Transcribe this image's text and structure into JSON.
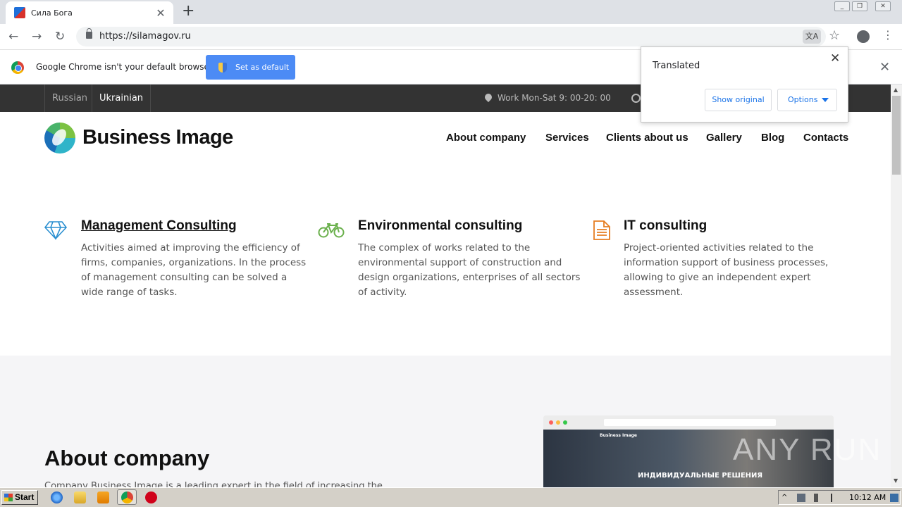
{
  "browser": {
    "tab_title": "Сила Бога",
    "url": "https://silamagov.ru",
    "new_tab_symbol": "+",
    "tab_close_symbol": "✕"
  },
  "infobar": {
    "message": "Google Chrome isn't your default browser",
    "button": "Set as default",
    "close_symbol": "✕"
  },
  "translate_popup": {
    "title": "Translated",
    "show_original": "Show original",
    "options": "Options",
    "close_symbol": "✕"
  },
  "site": {
    "languages": [
      "Russian",
      "Ukrainian"
    ],
    "hours": "Work Mon-Sat 9: 00-20: 00",
    "logo_text": "Business Image",
    "nav": [
      "About company",
      "Services",
      "Clients about us",
      "Gallery",
      "Blog",
      "Contacts"
    ],
    "services": [
      {
        "title": "Management Consulting",
        "desc": "Activities aimed at improving the efficiency of firms, companies, organizations. In the process of management consulting can be solved a wide range of tasks.",
        "icon": "diamond-icon",
        "color": "#2a8fd0"
      },
      {
        "title": "Environmental consulting",
        "desc": "The complex of works related to the environmental support of construction and design organizations, enterprises of all sectors of activity.",
        "icon": "bicycle-icon",
        "color": "#6ab04c"
      },
      {
        "title": "IT consulting",
        "desc": "Project-oriented activities related to the information support of business processes, allowing to give an independent expert assessment.",
        "icon": "document-icon",
        "color": "#e67e22"
      }
    ],
    "about_title": "About company",
    "about_text": "Company  Business Image  is a leading expert in the field of increasing the",
    "mockup_brand": "Business Image",
    "mockup_heading": "ИНДИВИДУАЛЬНЫЕ РЕШЕНИЯ",
    "watermark": "ANY RUN"
  },
  "taskbar": {
    "start": "Start",
    "clock": "10:12 AM"
  }
}
